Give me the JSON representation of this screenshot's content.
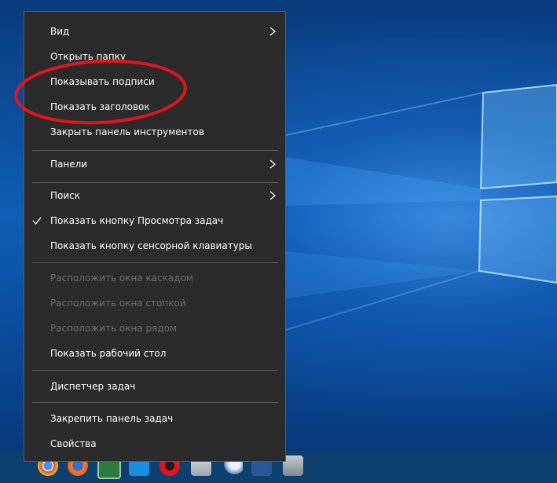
{
  "menu": {
    "items": [
      {
        "label": "Вид",
        "has_submenu": true
      },
      {
        "label": "Открыть папку"
      },
      {
        "label": "Показывать подписи"
      },
      {
        "label": "Показать заголовок"
      },
      {
        "label": "Закрыть панель инструментов"
      },
      {
        "label": "Панели",
        "has_submenu": true
      },
      {
        "label": "Поиск",
        "has_submenu": true
      },
      {
        "label": "Показать кнопку Просмотра задач",
        "checked": true
      },
      {
        "label": "Показать кнопку сенсорной клавиатуры"
      },
      {
        "label": "Расположить окна каскадом",
        "disabled": true
      },
      {
        "label": "Расположить окна стопкой",
        "disabled": true
      },
      {
        "label": "Расположить окна рядом",
        "disabled": true
      },
      {
        "label": "Показать рабочий стол"
      },
      {
        "label": "Диспетчер задач"
      },
      {
        "label": "Закрепить панель задач"
      },
      {
        "label": "Свойства"
      }
    ]
  },
  "annotation": {
    "color": "#e3141b",
    "target": "Показывать подписи / Показать заголовок"
  },
  "colors": {
    "menu_bg": "#2b2b2b",
    "desktop": "#0f5fb6",
    "disabled_text": "#6d6d6d"
  },
  "taskbar": {
    "icons": [
      "chrome-icon",
      "firefox-icon",
      "app-icon",
      "folder-icon",
      "opera-icon",
      "printer-icon",
      "magnifier-icon",
      "word-icon",
      "database-icon"
    ]
  }
}
